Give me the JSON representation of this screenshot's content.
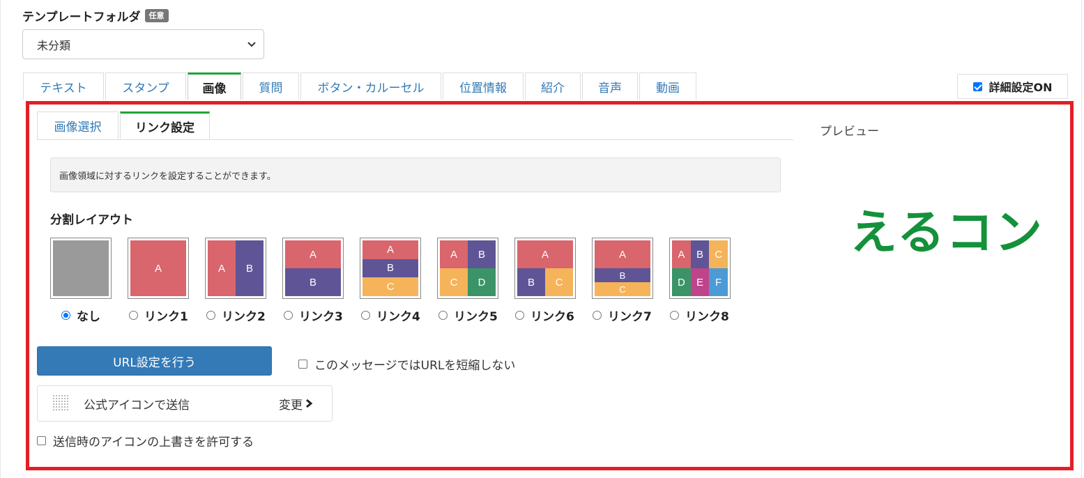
{
  "folder": {
    "label": "テンプレートフォルダ",
    "badge": "任意",
    "selected": "未分類"
  },
  "tabs": [
    {
      "label": "テキスト",
      "active": false
    },
    {
      "label": "スタンプ",
      "active": false
    },
    {
      "label": "画像",
      "active": true
    },
    {
      "label": "質問",
      "active": false
    },
    {
      "label": "ボタン・カルーセル",
      "active": false
    },
    {
      "label": "位置情報",
      "active": false
    },
    {
      "label": "紹介",
      "active": false
    },
    {
      "label": "音声",
      "active": false
    },
    {
      "label": "動画",
      "active": false
    }
  ],
  "detail_toggle": {
    "label": "詳細設定ON",
    "checked": true
  },
  "subtabs": [
    {
      "label": "画像選択",
      "active": false
    },
    {
      "label": "リンク設定",
      "active": true
    }
  ],
  "info": "画像領域に対するリンクを設定することができます。",
  "layout": {
    "title": "分割レイアウト",
    "options": [
      {
        "label": "なし",
        "checked": true,
        "cells": []
      },
      {
        "label": "リンク1",
        "checked": false,
        "cells": [
          "A"
        ]
      },
      {
        "label": "リンク2",
        "checked": false,
        "cells": [
          "A",
          "B"
        ]
      },
      {
        "label": "リンク3",
        "checked": false,
        "cells": [
          "A",
          "B"
        ]
      },
      {
        "label": "リンク4",
        "checked": false,
        "cells": [
          "A",
          "B",
          "C"
        ]
      },
      {
        "label": "リンク5",
        "checked": false,
        "cells": [
          "A",
          "B",
          "C",
          "D"
        ]
      },
      {
        "label": "リンク6",
        "checked": false,
        "cells": [
          "A",
          "B",
          "C"
        ]
      },
      {
        "label": "リンク7",
        "checked": false,
        "cells": [
          "A",
          "B",
          "C"
        ]
      },
      {
        "label": "リンク8",
        "checked": false,
        "cells": [
          "A",
          "B",
          "C",
          "D",
          "E",
          "F"
        ]
      }
    ],
    "colors": {
      "a": "#d9656d",
      "b": "#5f5596",
      "c": "#f5b35a",
      "d": "#3a9468",
      "e": "#c0448a",
      "f": "#4b9bd6",
      "none": "#9a9a9a"
    }
  },
  "url_button": "URL設定を行う",
  "shorten": {
    "label": "このメッセージではURLを短縮しない",
    "checked": false
  },
  "icon_select": {
    "label": "公式アイコンで送信",
    "change": "変更"
  },
  "override": {
    "label": "送信時のアイコンの上書きを許可する",
    "checked": false
  },
  "preview": {
    "label": "プレビュー",
    "logo": "えるコン",
    "logo_color": "#14913a"
  },
  "accent": {
    "highlight_frame": "#e31e26",
    "tab_active": "#22a33a",
    "link": "#337ab7"
  }
}
